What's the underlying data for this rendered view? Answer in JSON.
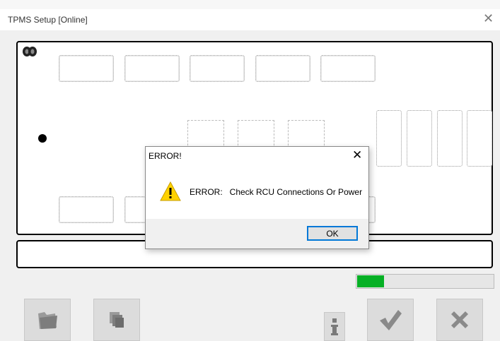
{
  "window": {
    "title": "TPMS Setup  [Online]",
    "close_icon": "close-icon"
  },
  "main_panel": {
    "icon": "tire-icon",
    "status_dot_color": "#000000"
  },
  "message_panel": {
    "text": ""
  },
  "progress": {
    "value_fraction": 0.2,
    "color": "#06b025"
  },
  "toolbar": {
    "buttons": [
      {
        "name": "open-folder-button",
        "icon": "folder-icon"
      },
      {
        "name": "copy-button",
        "icon": "copy-icon"
      },
      {
        "name": "info-button",
        "icon": "info-icon"
      },
      {
        "name": "accept-button",
        "icon": "checkmark-icon"
      },
      {
        "name": "cancel-button",
        "icon": "x-icon"
      }
    ]
  },
  "dialog": {
    "title": "ERROR!",
    "icon": "warning-icon",
    "message": "ERROR:   Check RCU Connections Or Power",
    "ok_label": "OK"
  }
}
